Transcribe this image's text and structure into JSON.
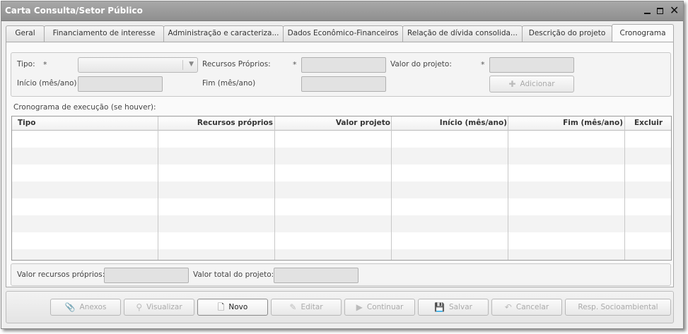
{
  "window": {
    "title": "Carta Consulta/Setor Público"
  },
  "tabs": [
    {
      "label": "Geral"
    },
    {
      "label": "Financiamento de interesse"
    },
    {
      "label": "Administração e caracteriza..."
    },
    {
      "label": "Dados Econômico-Financeiros"
    },
    {
      "label": "Relação de dívida consolida..."
    },
    {
      "label": "Descrição do projeto"
    },
    {
      "label": "Cronograma",
      "active": true
    }
  ],
  "form": {
    "tipo_label": "Tipo:",
    "required_mark": "*",
    "tipo_value": "",
    "recursos_proprios_label": "Recursos Próprios:",
    "recursos_proprios_value": "",
    "valor_projeto_label": "Valor do projeto:",
    "valor_projeto_value": "",
    "inicio_label": "Início (mês/ano)",
    "inicio_value": "",
    "fim_label": "Fim (mês/ano)",
    "fim_value": "",
    "adicionar_label": "Adicionar"
  },
  "cronograma": {
    "section_label": "Cronograma de execução (se houver):",
    "columns": [
      "Tipo",
      "Recursos próprios",
      "Valor projeto",
      "Início (mês/ano)",
      "Fim (mês/ano)",
      "Excluir"
    ],
    "rows": []
  },
  "totals": {
    "recursos_proprios_label": "Valor recursos próprios:",
    "recursos_proprios_value": "",
    "total_projeto_label": "Valor total do projeto:",
    "total_projeto_value": ""
  },
  "actions": {
    "anexos": "Anexos",
    "visualizar": "Visualizar",
    "novo": "Novo",
    "editar": "Editar",
    "continuar": "Continuar",
    "salvar": "Salvar",
    "cancelar": "Cancelar",
    "resp_socioambiental": "Resp. Socioambiental"
  },
  "icons": {
    "anexos": "paperclip-icon",
    "visualizar": "magnifier-icon",
    "novo": "new-document-icon",
    "editar": "pencil-icon",
    "continuar": "play-arrow-icon",
    "salvar": "floppy-disk-icon",
    "cancelar": "undo-arrow-icon",
    "adicionar": "plus-icon"
  }
}
